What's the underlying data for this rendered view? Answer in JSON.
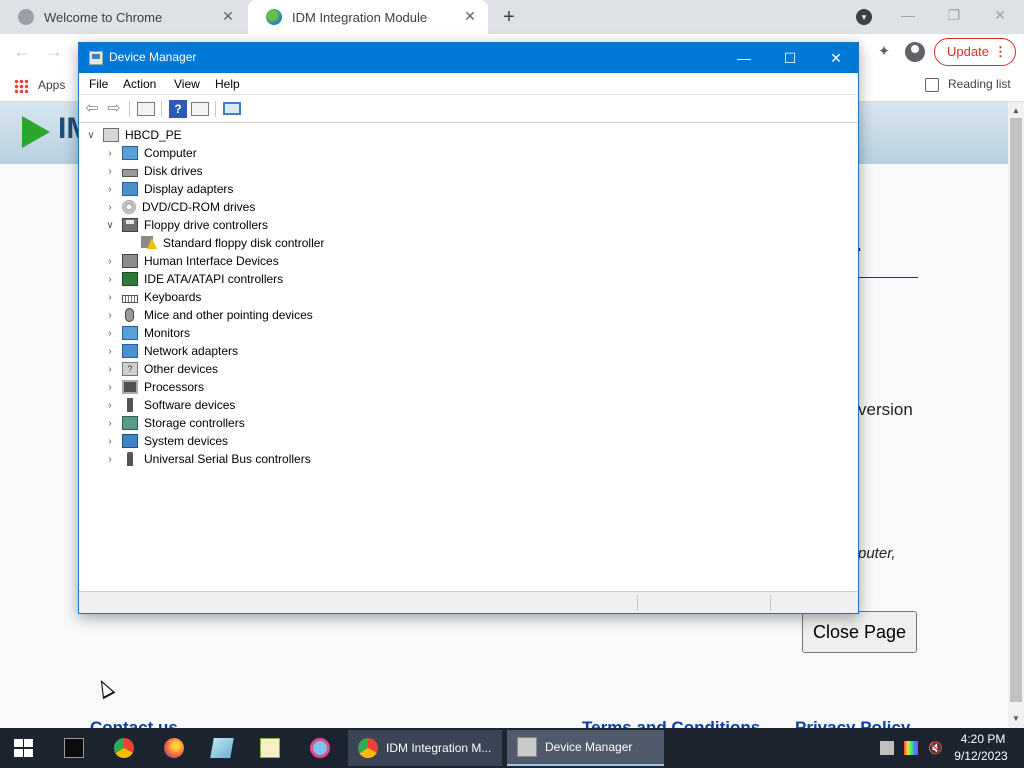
{
  "browser": {
    "tabs": [
      {
        "title": "Welcome to Chrome"
      },
      {
        "title": "IDM Integration Module"
      }
    ],
    "update_label": "Update",
    "bookmarks": {
      "apps_label": "Apps",
      "reading_list_label": "Reading list"
    }
  },
  "webpage": {
    "logo_text": "IM",
    "version_fragment": "version",
    "computer_fragment": "puter,",
    "close_page_label": "Close Page",
    "contact_link": "Contact us",
    "terms_link": "Terms and Conditions",
    "privacy_link": "Privacy Policy"
  },
  "device_manager": {
    "title": "Device Manager",
    "menu": [
      "File",
      "Action",
      "View",
      "Help"
    ],
    "tree": {
      "root": "HBCD_PE",
      "categories": [
        {
          "label": "Computer",
          "icon": "computer-icon",
          "expanded": false
        },
        {
          "label": "Disk drives",
          "icon": "disk-drive-icon",
          "expanded": false
        },
        {
          "label": "Display adapters",
          "icon": "display-adapter-icon",
          "expanded": false
        },
        {
          "label": "DVD/CD-ROM drives",
          "icon": "dvd-drive-icon",
          "expanded": false
        },
        {
          "label": "Floppy drive controllers",
          "icon": "floppy-controller-icon",
          "expanded": true,
          "children": [
            {
              "label": "Standard floppy disk controller",
              "icon": "warning-device-icon"
            }
          ]
        },
        {
          "label": "Human Interface Devices",
          "icon": "hid-icon",
          "expanded": false
        },
        {
          "label": "IDE ATA/ATAPI controllers",
          "icon": "ide-controller-icon",
          "expanded": false
        },
        {
          "label": "Keyboards",
          "icon": "keyboard-icon",
          "expanded": false
        },
        {
          "label": "Mice and other pointing devices",
          "icon": "mouse-icon",
          "expanded": false
        },
        {
          "label": "Monitors",
          "icon": "monitor-icon",
          "expanded": false
        },
        {
          "label": "Network adapters",
          "icon": "network-adapter-icon",
          "expanded": false
        },
        {
          "label": "Other devices",
          "icon": "other-devices-icon",
          "expanded": false
        },
        {
          "label": "Processors",
          "icon": "processor-icon",
          "expanded": false
        },
        {
          "label": "Software devices",
          "icon": "software-device-icon",
          "expanded": false
        },
        {
          "label": "Storage controllers",
          "icon": "storage-controller-icon",
          "expanded": false
        },
        {
          "label": "System devices",
          "icon": "system-device-icon",
          "expanded": false
        },
        {
          "label": "Universal Serial Bus controllers",
          "icon": "usb-icon",
          "expanded": false
        }
      ]
    }
  },
  "taskbar": {
    "tasks": [
      {
        "label": "IDM Integration M...",
        "icon": "chrome-icon"
      },
      {
        "label": "Device Manager",
        "icon": "device-manager-icon"
      }
    ],
    "clock": {
      "time": "4:20 PM",
      "date": "9/12/2023"
    }
  },
  "colors": {
    "title_bar": "#0078d7",
    "taskbar": "#1c2430",
    "update_accent": "#d93025",
    "link_blue": "#0b3fa5"
  }
}
